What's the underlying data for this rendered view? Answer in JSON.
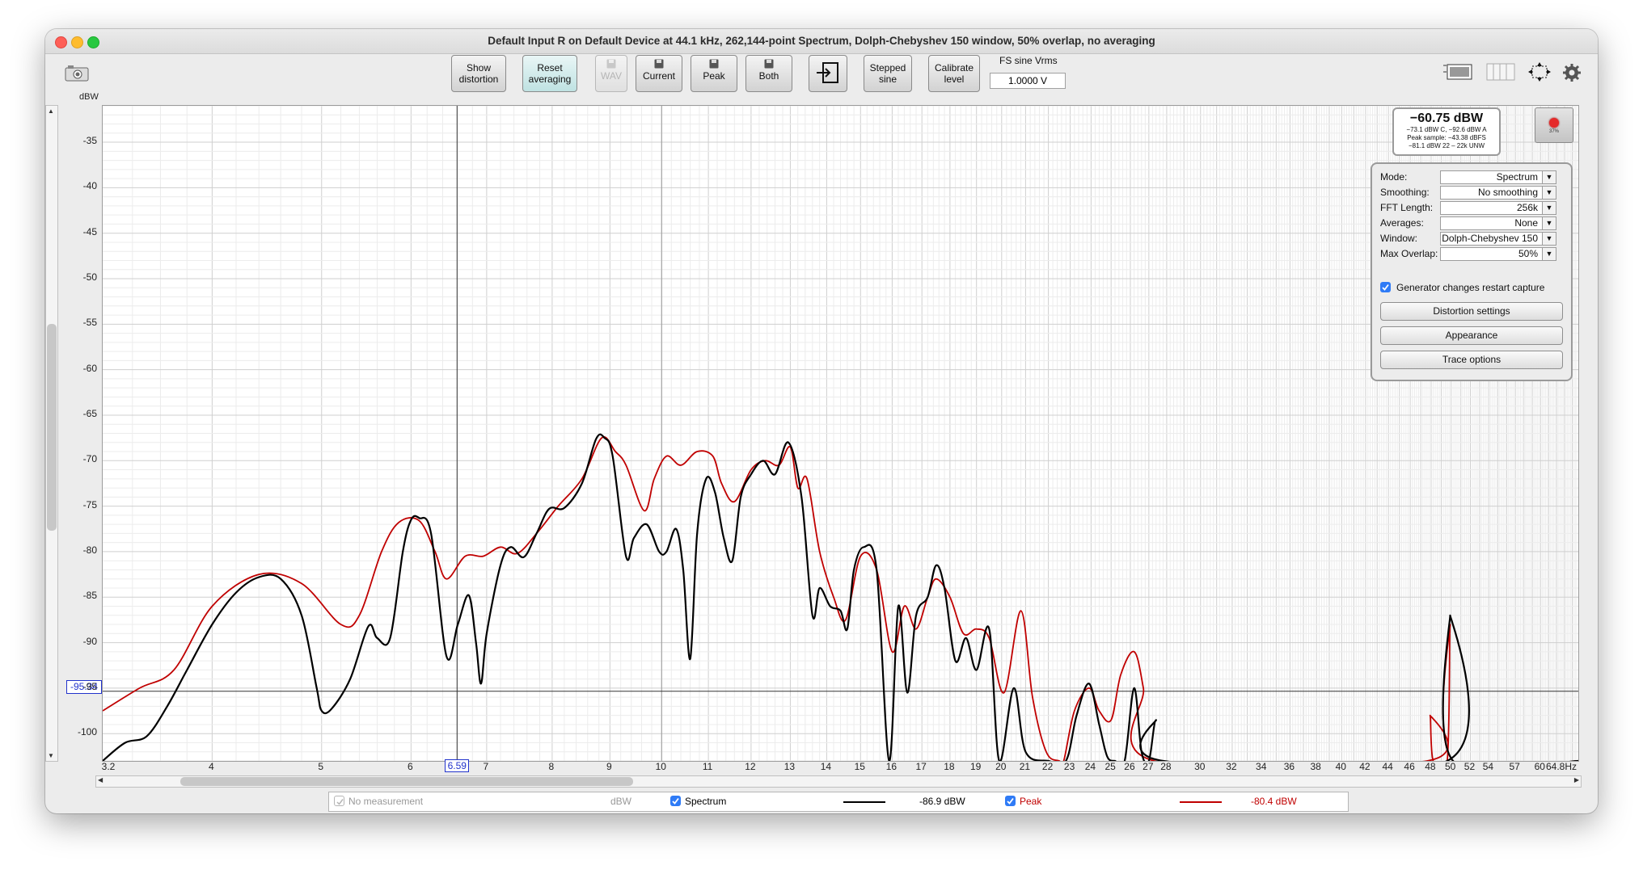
{
  "window": {
    "title": "Default Input R on Default Device at 44.1 kHz, 262,144-point Spectrum, Dolph-Chebyshev 150 window, 50% overlap, no averaging"
  },
  "toolbar": {
    "show_distortion": "Show distortion",
    "reset_averaging": "Reset averaging",
    "wav": "WAV",
    "current": "Current",
    "peak": "Peak",
    "both": "Both",
    "stepped_sine": "Stepped sine",
    "calibrate_level": "Calibrate level",
    "fs_sine_label": "FS sine Vrms",
    "fs_sine_value": "1.0000 V"
  },
  "readout": {
    "main": "−60.75 dBW",
    "line1": "−73.1 dBW C, −92.6 dBW A",
    "line2": "Peak sample: −43.38 dBFS",
    "line3": "−81.1 dBW 22 – 22k UNW",
    "meter_percent": "37%"
  },
  "panel": {
    "rows": [
      {
        "label": "Mode:",
        "value": "Spectrum"
      },
      {
        "label": "Smoothing:",
        "value": "No  smoothing"
      },
      {
        "label": "FFT Length:",
        "value": "256k"
      },
      {
        "label": "Averages:",
        "value": "None"
      },
      {
        "label": "Window:",
        "value": "Dolph-Chebyshev 150"
      },
      {
        "label": "Max Overlap:",
        "value": "50%"
      }
    ],
    "checkbox_label": "Generator changes restart capture",
    "checkbox_checked": true,
    "buttons": [
      "Distortion settings",
      "Appearance",
      "Trace options"
    ]
  },
  "cursor": {
    "x_label": "6.59",
    "y_label": "-95.34"
  },
  "legend": {
    "no_measurement": "No measurement",
    "unit": "dBW",
    "spectrum": "Spectrum",
    "spectrum_value": "-86.9 dBW",
    "peak": "Peak",
    "peak_value": "-80.4 dBW",
    "spectrum_color": "#000000",
    "peak_color": "#c00000"
  },
  "chart_data": {
    "type": "line",
    "xlabel": "Hz",
    "ylabel": "dBW",
    "xscale": "log",
    "xlim": [
      3.2,
      64.8
    ],
    "ylim": [
      -103,
      -31
    ],
    "x_ticks": [
      "3.2",
      "4",
      "5",
      "6",
      "7",
      "8",
      "9",
      "10",
      "11",
      "12",
      "13",
      "14",
      "15",
      "16",
      "17",
      "18",
      "19",
      "20",
      "21",
      "22",
      "23",
      "24",
      "25",
      "26",
      "27",
      "28",
      "30",
      "32",
      "34",
      "36",
      "38",
      "40",
      "42",
      "44",
      "46",
      "48",
      "50",
      "52",
      "54",
      "57",
      "60",
      "64.8Hz"
    ],
    "y_ticks": [
      "-35",
      "-40",
      "-45",
      "-50",
      "-55",
      "-60",
      "-65",
      "-70",
      "-75",
      "-80",
      "-85",
      "-90",
      "-95",
      "-100"
    ],
    "grid": true,
    "series": [
      {
        "name": "Spectrum",
        "color": "#000000",
        "points": [
          [
            3.2,
            -103
          ],
          [
            3.35,
            -101
          ],
          [
            3.5,
            -100.3
          ],
          [
            3.65,
            -97
          ],
          [
            3.8,
            -93
          ],
          [
            4.0,
            -88
          ],
          [
            4.2,
            -84.5
          ],
          [
            4.4,
            -82.8
          ],
          [
            4.6,
            -83
          ],
          [
            4.8,
            -87
          ],
          [
            4.95,
            -95
          ],
          [
            5.0,
            -97.5
          ],
          [
            5.1,
            -97.3
          ],
          [
            5.3,
            -94
          ],
          [
            5.5,
            -88.2
          ],
          [
            5.6,
            -89.5
          ],
          [
            5.75,
            -89.5
          ],
          [
            5.9,
            -80
          ],
          [
            6.0,
            -76.5
          ],
          [
            6.1,
            -76.3
          ],
          [
            6.25,
            -78
          ],
          [
            6.45,
            -91.5
          ],
          [
            6.6,
            -88
          ],
          [
            6.75,
            -84.8
          ],
          [
            6.85,
            -90
          ],
          [
            6.92,
            -94.5
          ],
          [
            7.0,
            -89
          ],
          [
            7.2,
            -81.5
          ],
          [
            7.35,
            -79.5
          ],
          [
            7.55,
            -80.6
          ],
          [
            7.75,
            -78
          ],
          [
            7.95,
            -75.3
          ],
          [
            8.2,
            -75.2
          ],
          [
            8.5,
            -72.5
          ],
          [
            8.75,
            -67.6
          ],
          [
            8.9,
            -67.5
          ],
          [
            9.05,
            -69.5
          ],
          [
            9.3,
            -80.5
          ],
          [
            9.45,
            -78.5
          ],
          [
            9.7,
            -77
          ],
          [
            9.95,
            -80
          ],
          [
            10.1,
            -80
          ],
          [
            10.3,
            -77.5
          ],
          [
            10.45,
            -82
          ],
          [
            10.6,
            -91.8
          ],
          [
            10.75,
            -78
          ],
          [
            10.95,
            -72
          ],
          [
            11.15,
            -73.5
          ],
          [
            11.35,
            -78.5
          ],
          [
            11.55,
            -81
          ],
          [
            11.75,
            -74
          ],
          [
            12.0,
            -71.5
          ],
          [
            12.3,
            -70
          ],
          [
            12.6,
            -71.5
          ],
          [
            12.95,
            -68
          ],
          [
            13.3,
            -74
          ],
          [
            13.6,
            -87
          ],
          [
            13.8,
            -84
          ],
          [
            14.1,
            -86
          ],
          [
            14.4,
            -86.5
          ],
          [
            14.6,
            -88.5
          ],
          [
            14.8,
            -82
          ],
          [
            15.1,
            -79.5
          ],
          [
            15.5,
            -82
          ],
          [
            15.9,
            -103
          ],
          [
            16.2,
            -86
          ],
          [
            16.5,
            -95.5
          ],
          [
            16.8,
            -87
          ],
          [
            17.2,
            -85
          ],
          [
            17.5,
            -81.5
          ],
          [
            17.8,
            -84
          ],
          [
            18.2,
            -92
          ],
          [
            18.6,
            -89.5
          ],
          [
            19.0,
            -93
          ],
          [
            19.5,
            -88.5
          ],
          [
            19.9,
            -103
          ],
          [
            20.5,
            -95
          ],
          [
            21.0,
            -102
          ],
          [
            22.0,
            -103
          ],
          [
            22.8,
            -103
          ],
          [
            23.3,
            -98
          ],
          [
            23.9,
            -94.5
          ],
          [
            24.4,
            -99
          ],
          [
            24.8,
            -102.5
          ],
          [
            25.2,
            -103
          ],
          [
            25.7,
            -103
          ],
          [
            26.2,
            -95
          ],
          [
            26.6,
            -102
          ],
          [
            27.0,
            -103
          ],
          [
            27.4,
            -98.5
          ],
          [
            27.8,
            -103
          ],
          [
            49.6,
            -103
          ],
          [
            49.9,
            -87
          ],
          [
            50.2,
            -103
          ],
          [
            64.8,
            -103
          ]
        ]
      },
      {
        "name": "Peak",
        "color": "#c00000",
        "points": [
          [
            3.2,
            -97.5
          ],
          [
            3.45,
            -95
          ],
          [
            3.7,
            -93
          ],
          [
            4.0,
            -86
          ],
          [
            4.4,
            -82.5
          ],
          [
            4.8,
            -83.5
          ],
          [
            5.2,
            -88
          ],
          [
            5.4,
            -87
          ],
          [
            5.65,
            -80
          ],
          [
            5.85,
            -76.8
          ],
          [
            6.1,
            -76.6
          ],
          [
            6.3,
            -80
          ],
          [
            6.45,
            -83
          ],
          [
            6.7,
            -80.5
          ],
          [
            6.95,
            -80.5
          ],
          [
            7.2,
            -79.5
          ],
          [
            7.45,
            -80.2
          ],
          [
            7.75,
            -78
          ],
          [
            8.1,
            -75
          ],
          [
            8.5,
            -72
          ],
          [
            8.85,
            -67.5
          ],
          [
            9.1,
            -69
          ],
          [
            9.3,
            -70.5
          ],
          [
            9.65,
            -75.5
          ],
          [
            9.85,
            -72
          ],
          [
            10.1,
            -69.5
          ],
          [
            10.4,
            -70.5
          ],
          [
            10.75,
            -69
          ],
          [
            11.1,
            -69.5
          ],
          [
            11.3,
            -72.5
          ],
          [
            11.6,
            -74.5
          ],
          [
            12.0,
            -71
          ],
          [
            12.35,
            -70
          ],
          [
            12.7,
            -70.5
          ],
          [
            13.0,
            -68.5
          ],
          [
            13.2,
            -73
          ],
          [
            13.45,
            -72
          ],
          [
            13.8,
            -80
          ],
          [
            14.2,
            -85
          ],
          [
            14.55,
            -87.5
          ],
          [
            15.0,
            -80.5
          ],
          [
            15.5,
            -82
          ],
          [
            16.0,
            -91
          ],
          [
            16.4,
            -86
          ],
          [
            16.8,
            -88.5
          ],
          [
            17.2,
            -85
          ],
          [
            17.5,
            -83
          ],
          [
            18.0,
            -85
          ],
          [
            18.5,
            -89
          ],
          [
            19.0,
            -88.5
          ],
          [
            19.5,
            -89.5
          ],
          [
            20.1,
            -95.5
          ],
          [
            20.8,
            -86.5
          ],
          [
            21.3,
            -96
          ],
          [
            21.9,
            -102
          ],
          [
            22.5,
            -103
          ],
          [
            22.7,
            -103
          ],
          [
            23.2,
            -97.5
          ],
          [
            23.9,
            -95
          ],
          [
            24.4,
            -97.5
          ],
          [
            25.0,
            -98.5
          ],
          [
            25.5,
            -93.5
          ],
          [
            26.2,
            -91
          ],
          [
            26.7,
            -95
          ],
          [
            27.3,
            -103
          ],
          [
            47.6,
            -103
          ],
          [
            47.9,
            -98
          ],
          [
            48.2,
            -103
          ],
          [
            49.6,
            -103
          ],
          [
            49.9,
            -88
          ],
          [
            50.2,
            -103
          ],
          [
            64.8,
            -103
          ]
        ]
      }
    ]
  }
}
